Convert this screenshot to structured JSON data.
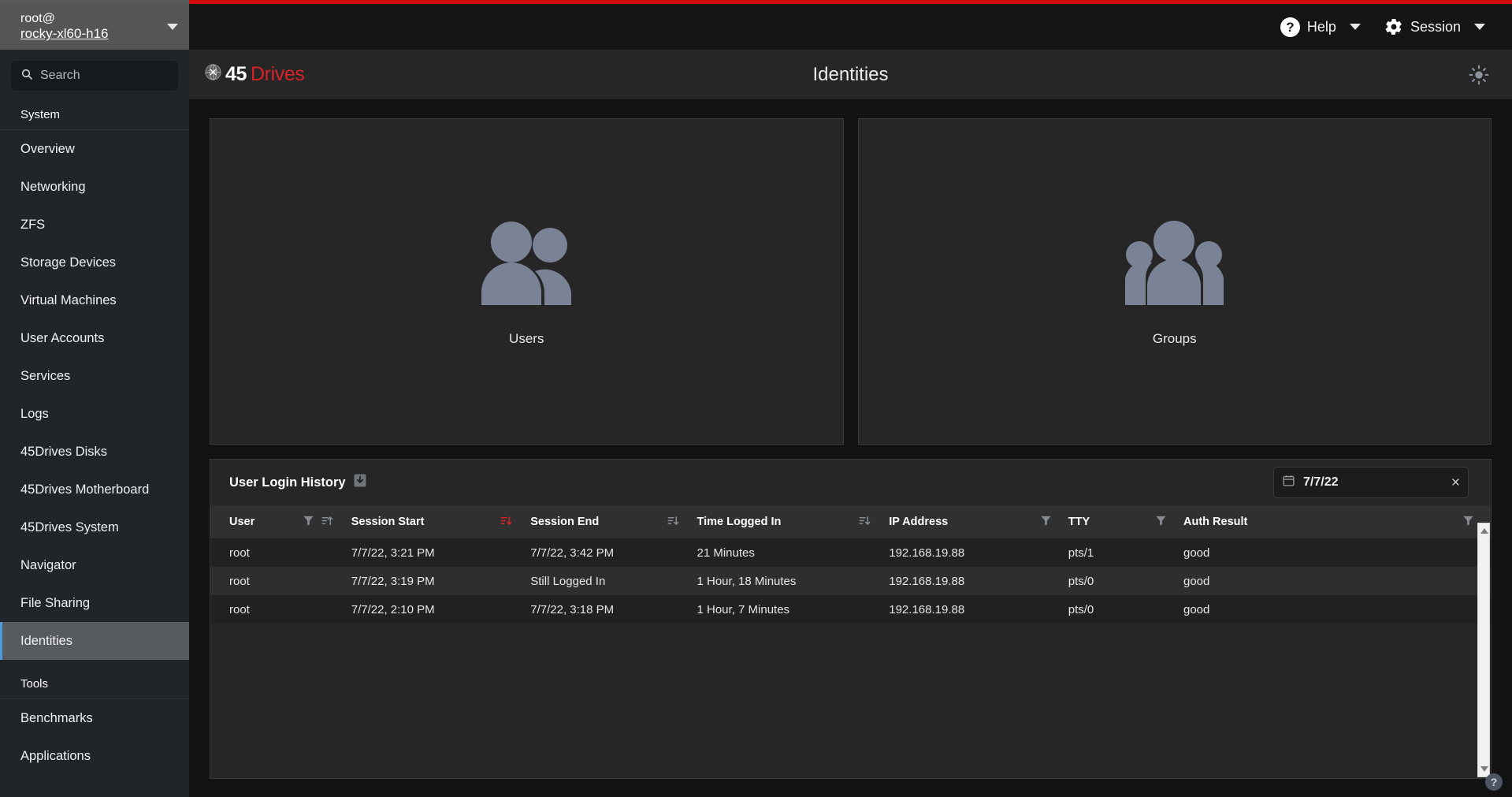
{
  "theme": {
    "accent_red": "#cf0a0a",
    "brand_red": "#d8232a",
    "active_blue": "#4b9ae0",
    "icon_gray": "#7a8396"
  },
  "host": {
    "user": "root@",
    "hostname": "rocky-xl60-h16"
  },
  "topbar": {
    "help_label": "Help",
    "session_label": "Session"
  },
  "sidebar": {
    "search_placeholder": "Search",
    "groups": [
      {
        "header": "System",
        "items": [
          {
            "label": "Overview",
            "active": false
          },
          {
            "label": "Networking",
            "active": false
          },
          {
            "label": "ZFS",
            "active": false
          },
          {
            "label": "Storage Devices",
            "active": false
          },
          {
            "label": "Virtual Machines",
            "active": false
          },
          {
            "label": "User Accounts",
            "active": false
          },
          {
            "label": "Services",
            "active": false
          },
          {
            "label": "Logs",
            "active": false
          },
          {
            "label": "45Drives Disks",
            "active": false
          },
          {
            "label": "45Drives Motherboard",
            "active": false
          },
          {
            "label": "45Drives System",
            "active": false
          },
          {
            "label": "Navigator",
            "active": false
          },
          {
            "label": "File Sharing",
            "active": false
          },
          {
            "label": "Identities",
            "active": true
          }
        ]
      },
      {
        "header": "Tools",
        "items": [
          {
            "label": "Benchmarks",
            "active": false
          },
          {
            "label": "Applications",
            "active": false
          }
        ]
      }
    ]
  },
  "page": {
    "brand_primary": "45",
    "brand_secondary": "Drives",
    "title": "Identities"
  },
  "cards": [
    {
      "label": "Users",
      "icon": "two-users-icon"
    },
    {
      "label": "Groups",
      "icon": "three-users-group-icon"
    }
  ],
  "login_history": {
    "title": "User Login History",
    "download_icon": "download-icon",
    "date_filter": {
      "value": "7/7/22",
      "icon": "calendar-icon",
      "clear": "×"
    },
    "columns": [
      {
        "label": "User",
        "filter": true,
        "sort": "asc",
        "sort_active": false
      },
      {
        "label": "Session Start",
        "filter": false,
        "sort": "desc",
        "sort_active": true
      },
      {
        "label": "Session End",
        "filter": false,
        "sort": "desc",
        "sort_active": false
      },
      {
        "label": "Time Logged In",
        "filter": false,
        "sort": "desc",
        "sort_active": false
      },
      {
        "label": "IP Address",
        "filter": true,
        "sort": null,
        "sort_active": false
      },
      {
        "label": "TTY",
        "filter": true,
        "sort": null,
        "sort_active": false
      },
      {
        "label": "Auth Result",
        "filter": true,
        "sort": null,
        "sort_active": false
      }
    ],
    "rows": [
      {
        "user": "root",
        "session_start": "7/7/22, 3:21 PM",
        "session_end": "7/7/22, 3:42 PM",
        "time_logged_in": "21 Minutes",
        "ip": "192.168.19.88",
        "tty": "pts/1",
        "auth": "good"
      },
      {
        "user": "root",
        "session_start": "7/7/22, 3:19 PM",
        "session_end": "Still Logged In",
        "time_logged_in": "1 Hour, 18 Minutes",
        "ip": "192.168.19.88",
        "tty": "pts/0",
        "auth": "good"
      },
      {
        "user": "root",
        "session_start": "7/7/22, 2:10 PM",
        "session_end": "7/7/22, 3:18 PM",
        "time_logged_in": "1 Hour, 7 Minutes",
        "ip": "192.168.19.88",
        "tty": "pts/0",
        "auth": "good"
      }
    ]
  },
  "corner": {
    "help_glyph": "?"
  }
}
